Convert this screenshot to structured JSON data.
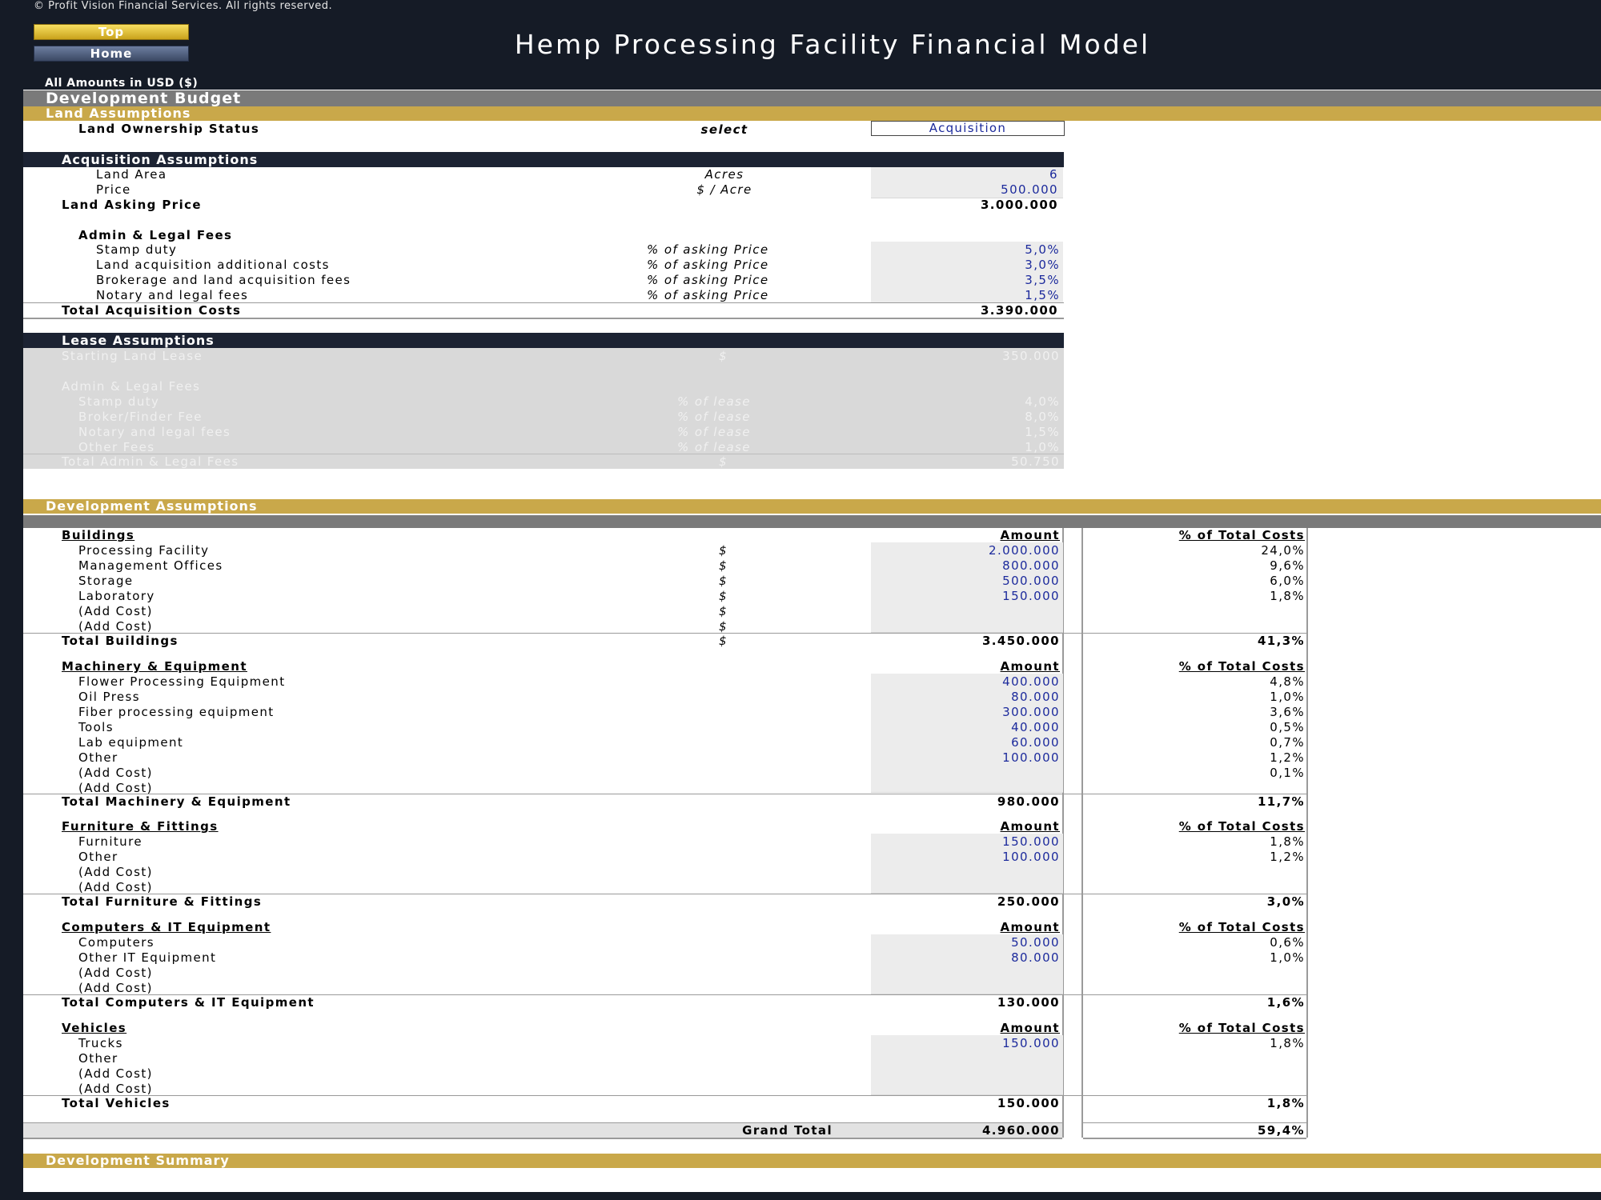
{
  "copyright": "© Profit Vision Financial Services. All rights reserved.",
  "nav": {
    "top": "Top",
    "home": "Home"
  },
  "title": "Hemp Processing Facility Financial Model",
  "amounts_label": "All Amounts in  USD ($)",
  "development_budget": "Development Budget",
  "land_assumptions": "Land Assumptions",
  "land_ownership": {
    "label": "Land Ownership Status",
    "unit": "select",
    "value": "Acquisition"
  },
  "acquisition": {
    "header": "Acquisition Assumptions",
    "land_area": {
      "label": "Land Area",
      "unit": "Acres",
      "value": "6"
    },
    "price": {
      "label": "Price",
      "unit": "$ / Acre",
      "value": "500.000"
    },
    "asking_price": {
      "label": "Land Asking Price",
      "value": "3.000.000"
    },
    "fees_title": "Admin & Legal Fees",
    "fees": [
      {
        "label": "Stamp duty",
        "unit": "% of asking Price",
        "value": "5,0%"
      },
      {
        "label": "Land acquisition additional costs",
        "unit": "% of asking Price",
        "value": "3,0%"
      },
      {
        "label": "Brokerage and land acquisition fees",
        "unit": "% of asking Price",
        "value": "3,5%"
      },
      {
        "label": "Notary and legal fees",
        "unit": "% of asking Price",
        "value": "1,5%"
      }
    ],
    "total": {
      "label": "Total Acquisition Costs",
      "value": "3.390.000"
    }
  },
  "lease": {
    "header": "Lease Assumptions",
    "starting": {
      "label": "Starting Land Lease",
      "unit": "$",
      "value": "350.000"
    },
    "fees_title": "Admin & Legal Fees",
    "fees": [
      {
        "label": "Stamp duty",
        "unit": "% of lease",
        "value": "4,0%"
      },
      {
        "label": "Broker/Finder Fee",
        "unit": "% of lease",
        "value": "8,0%"
      },
      {
        "label": "Notary and legal fees",
        "unit": "% of lease",
        "value": "1,5%"
      },
      {
        "label": "Other Fees",
        "unit": "% of lease",
        "value": "1,0%"
      }
    ],
    "total": {
      "label": "Total Admin & Legal Fees",
      "unit": "$",
      "value": "50.750"
    }
  },
  "development_assumptions": "Development Assumptions",
  "col_amount": "Amount",
  "col_pct": "% of Total Costs",
  "buildings": {
    "title": "Buildings",
    "items": [
      {
        "label": "Processing Facility",
        "unit": "$",
        "value": "2.000.000",
        "pct": "24,0%"
      },
      {
        "label": "Management Offices",
        "unit": "$",
        "value": "800.000",
        "pct": "9,6%"
      },
      {
        "label": "Storage",
        "unit": "$",
        "value": "500.000",
        "pct": "6,0%"
      },
      {
        "label": "Laboratory",
        "unit": "$",
        "value": "150.000",
        "pct": "1,8%"
      },
      {
        "label": "(Add Cost)",
        "unit": "$",
        "value": "",
        "pct": ""
      },
      {
        "label": "(Add Cost)",
        "unit": "$",
        "value": "",
        "pct": ""
      }
    ],
    "total": {
      "label": "Total Buildings",
      "unit": "$",
      "value": "3.450.000",
      "pct": "41,3%"
    }
  },
  "machinery": {
    "title": "Machinery & Equipment",
    "items": [
      {
        "label": "Flower Processing Equipment",
        "value": "400.000",
        "pct": "4,8%"
      },
      {
        "label": "Oil Press",
        "value": "80.000",
        "pct": "1,0%"
      },
      {
        "label": "Fiber processing equipment",
        "value": "300.000",
        "pct": "3,6%"
      },
      {
        "label": "Tools",
        "value": "40.000",
        "pct": "0,5%"
      },
      {
        "label": "Lab equipment",
        "value": "60.000",
        "pct": "0,7%"
      },
      {
        "label": "Other",
        "value": "100.000",
        "pct": "1,2%"
      },
      {
        "label": "(Add Cost)",
        "value": "",
        "pct": "0,1%"
      },
      {
        "label": "(Add Cost)",
        "value": "",
        "pct": ""
      }
    ],
    "total": {
      "label": "Total Machinery & Equipment",
      "value": "980.000",
      "pct": "11,7%"
    }
  },
  "furniture": {
    "title": "Furniture & Fittings",
    "items": [
      {
        "label": "Furniture",
        "value": "150.000",
        "pct": "1,8%"
      },
      {
        "label": "Other",
        "value": "100.000",
        "pct": "1,2%"
      },
      {
        "label": "(Add Cost)",
        "value": "",
        "pct": ""
      },
      {
        "label": "(Add Cost)",
        "value": "",
        "pct": ""
      }
    ],
    "total": {
      "label": "Total Furniture & Fittings",
      "value": "250.000",
      "pct": "3,0%"
    }
  },
  "computers": {
    "title": "Computers & IT Equipment",
    "items": [
      {
        "label": "Computers",
        "value": "50.000",
        "pct": "0,6%"
      },
      {
        "label": "Other IT Equipment",
        "value": "80.000",
        "pct": "1,0%"
      },
      {
        "label": "(Add Cost)",
        "value": "",
        "pct": ""
      },
      {
        "label": "(Add Cost)",
        "value": "",
        "pct": ""
      }
    ],
    "total": {
      "label": "Total Computers & IT Equipment",
      "value": "130.000",
      "pct": "1,6%"
    }
  },
  "vehicles": {
    "title": "Vehicles",
    "items": [
      {
        "label": "Trucks",
        "value": "150.000",
        "pct": "1,8%"
      },
      {
        "label": "Other",
        "value": "",
        "pct": ""
      },
      {
        "label": "(Add Cost)",
        "value": "",
        "pct": ""
      },
      {
        "label": "(Add Cost)",
        "value": "",
        "pct": ""
      }
    ],
    "total": {
      "label": "Total Vehicles",
      "value": "150.000",
      "pct": "1,8%"
    }
  },
  "grand_total": {
    "label": "Grand Total",
    "value": "4.960.000",
    "pct": "59,4%"
  },
  "development_summary": "Development Summary"
}
